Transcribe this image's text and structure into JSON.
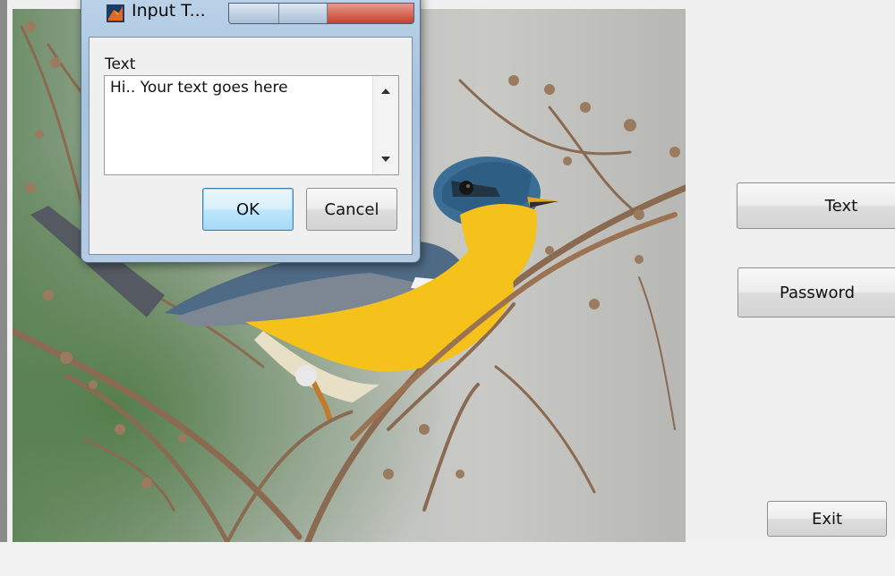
{
  "dialog": {
    "title": "Input T...",
    "field_label": "Text",
    "text_value": "Hi.. Your text goes here",
    "ok_label": "OK",
    "cancel_label": "Cancel"
  },
  "panel": {
    "text_button_label": "Text",
    "password_button_label": "Password",
    "exit_button_label": "Exit"
  },
  "colors": {
    "bird_yellow": "#f4c21a",
    "bird_blue": "#3b6e96",
    "photo_background": "#bfc4bf",
    "window_frame": "#a7c2dd"
  },
  "icons": {
    "app_icon": "matlab-icon",
    "scroll_up": "arrow-up-icon",
    "scroll_down": "arrow-down-icon"
  }
}
